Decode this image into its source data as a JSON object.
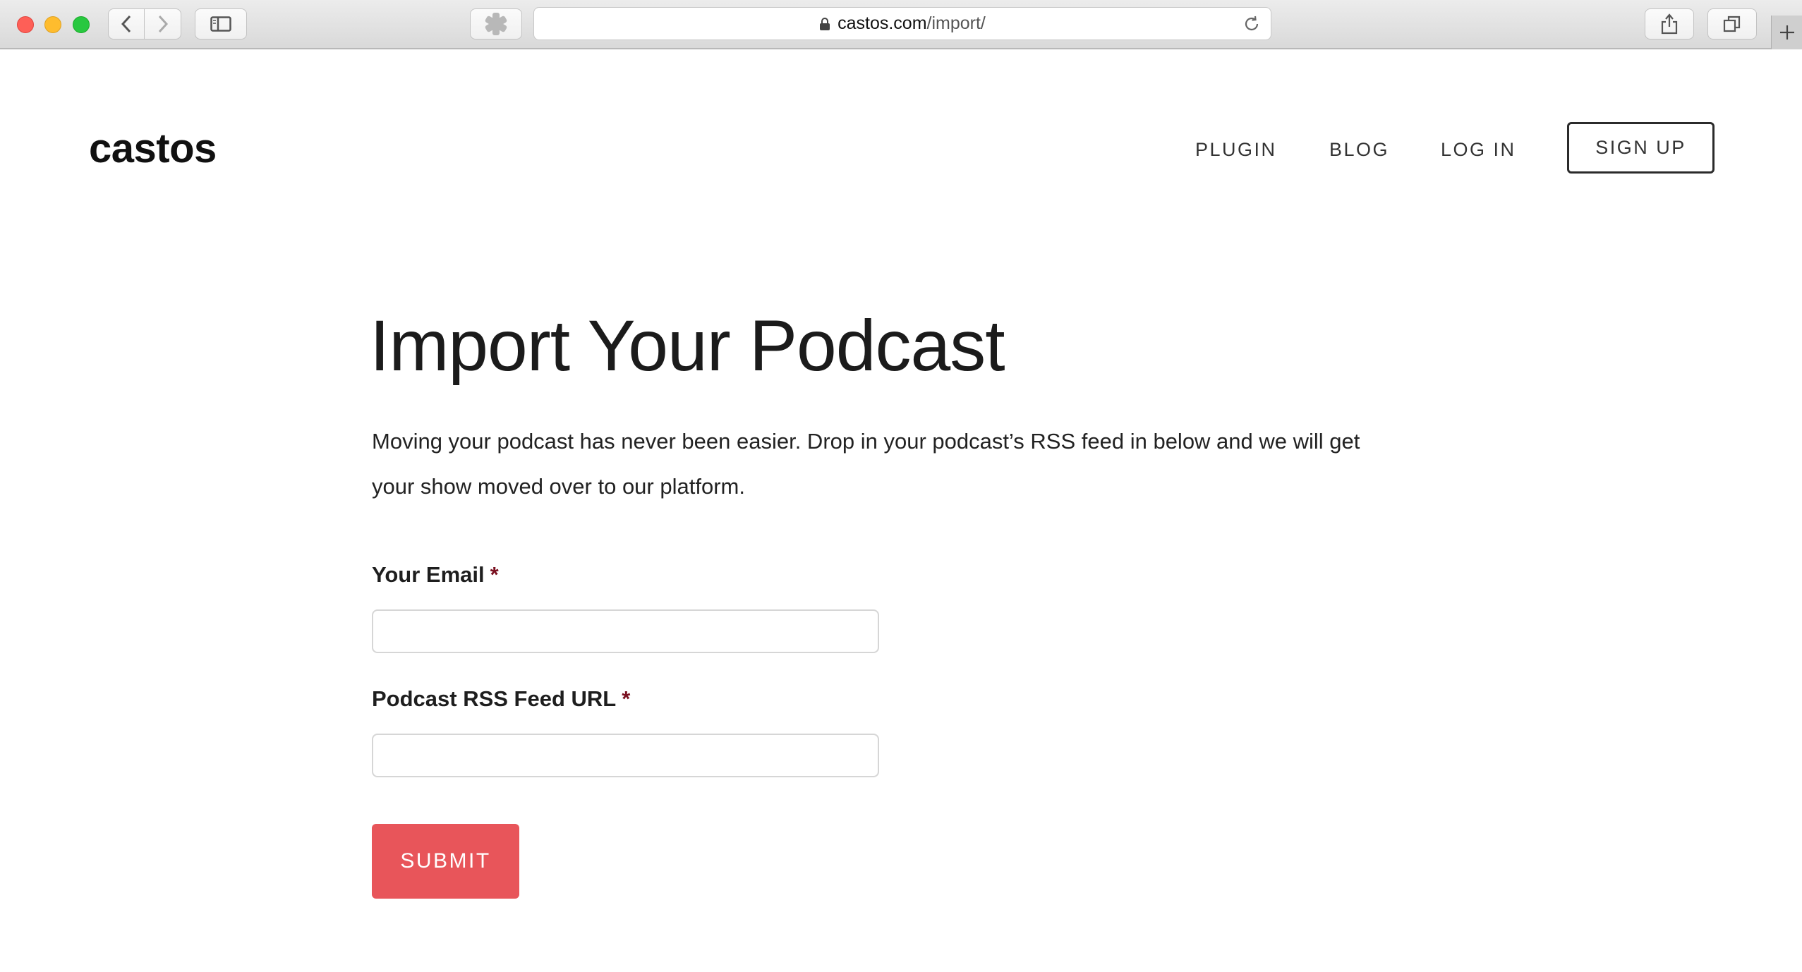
{
  "browser": {
    "url_host": "castos.com",
    "url_path": "/import/"
  },
  "header": {
    "logo": "castos",
    "nav": {
      "plugin": "PLUGIN",
      "blog": "BLOG",
      "login": "LOG IN",
      "signup": "SIGN UP"
    }
  },
  "main": {
    "title": "Import Your Podcast",
    "intro": "Moving your podcast has never been easier.  Drop in your podcast’s RSS feed in below and we will get your show moved over to our platform.",
    "form": {
      "email_label": "Your Email",
      "email_value": "",
      "rss_label": "Podcast RSS Feed URL",
      "rss_value": "",
      "required_marker": "*",
      "submit_label": "SUBMIT"
    }
  },
  "colors": {
    "submit_bg": "#e8555a",
    "required_marker": "#7a1020"
  }
}
